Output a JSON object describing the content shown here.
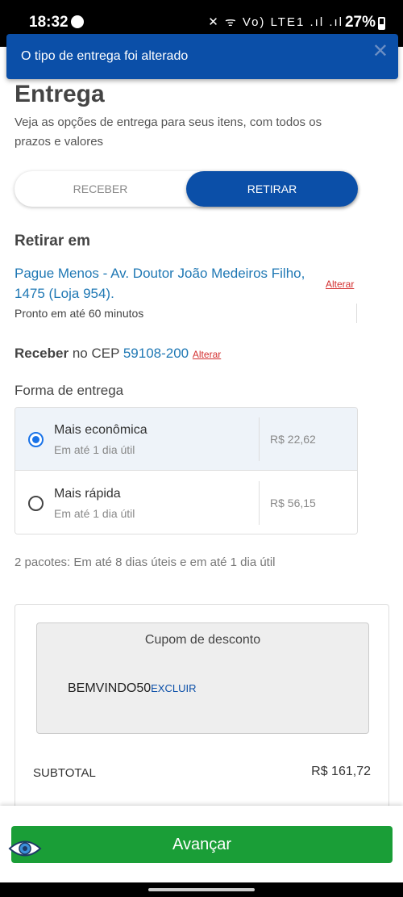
{
  "status_bar": {
    "time": "18:32",
    "signal_icons": "✕ ᯤ Vo) LTE1 .ıl .ıl",
    "battery": "27%"
  },
  "toast": {
    "message": "O tipo de entrega foi alterado",
    "close_glyph": "✕"
  },
  "page": {
    "title": "Entrega",
    "subtitle": "Veja as opções de entrega para seus itens, com todos os prazos e valores"
  },
  "delivery_toggle": {
    "receber_label": "RECEBER",
    "retirar_label": "RETIRAR",
    "selected": "RETIRAR"
  },
  "pickup": {
    "heading": "Retirar em",
    "store": "Pague Menos - Av. Doutor João Medeiros Filho, 1475 (Loja 954).",
    "change_label": "Alterar",
    "ready_text": "Pronto em até 60 minutos"
  },
  "cep": {
    "label_strong": "Receber",
    "label_rest": " no CEP ",
    "value": "59108-200",
    "change_label": "Alterar"
  },
  "shipping": {
    "heading": "Forma de entrega",
    "options": [
      {
        "name": "Mais econômica",
        "time": "Em até 1 dia útil",
        "price": "R$ 22,62",
        "selected": true
      },
      {
        "name": "Mais rápida",
        "time": "Em até 1 dia útil",
        "price": "R$ 56,15",
        "selected": false
      }
    ],
    "packages_text": "2 pacotes: Em até 8 dias úteis e em até 1 dia útil"
  },
  "summary": {
    "coupon_title": "Cupom de desconto",
    "coupon_code": "BEMVINDO50",
    "coupon_remove_label": "EXCLUIR",
    "subtotal_label": "SUBTOTAL",
    "subtotal_value": "R$ 161,72"
  },
  "footer": {
    "primary_button_label": "Avançar",
    "accessibility_icon": "eye-icon"
  },
  "colors": {
    "brand_blue": "#0b4fa8",
    "link_blue": "#1f78b4",
    "alert_red": "#d32f2f",
    "cta_green": "#1a9e37"
  }
}
